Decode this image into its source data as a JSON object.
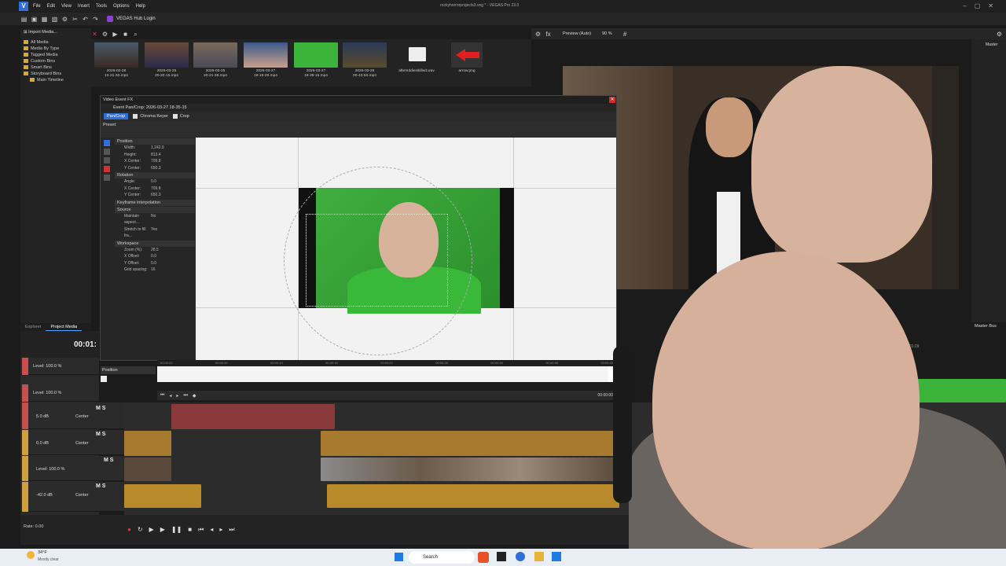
{
  "app": {
    "window_title": "rockyhorrorprojects3.veg * - VEGAS Pro 23.0",
    "menu": [
      "File",
      "Edit",
      "View",
      "Insert",
      "Tools",
      "Options",
      "Help"
    ],
    "hub_label": "VEGAS Hub Login"
  },
  "explorer": {
    "import_label": "Import Media...",
    "tree": [
      "All Media",
      "Media By Type",
      "Tagged Media",
      "Custom Bins",
      "Smart Bins",
      "Storyboard Bins",
      "Main Timeline"
    ],
    "tabs": [
      "Explorer",
      "Project Media"
    ]
  },
  "media": [
    {
      "name": "2026-02-28\n12-21-30.mp4"
    },
    {
      "name": "2026-03-25\n20-20-15.mp4"
    },
    {
      "name": "2026-03-25\n20-21-38.mp4"
    },
    {
      "name": "2026-03-27\n18-16-29.mp4"
    },
    {
      "name": "2026-03-27\n18-35-15.mp4"
    },
    {
      "name": "2026-03-28\n00-43-50.mp4"
    },
    {
      "name": "aftereddieiskilled.wav"
    },
    {
      "name": "arrow.png"
    }
  ],
  "preview_toolbar": {
    "mode": "Preview (Auto)",
    "zoom": "90 %"
  },
  "vefx": {
    "title": "Video Event FX",
    "event": "Event Pan/Crop: 2026-03-27 18-35-15",
    "chain": [
      "Pan/Crop",
      "Chroma Keyer",
      "Crop"
    ],
    "preset_label": "Preset:",
    "sections": [
      {
        "name": "Position",
        "rows": [
          [
            "Width:",
            "1,242.9"
          ],
          [
            "Height:",
            "813.4"
          ],
          [
            "X Center:",
            "709.8"
          ],
          [
            "Y Center:",
            "650.3"
          ]
        ]
      },
      {
        "name": "Rotation",
        "rows": [
          [
            "Angle:",
            "0.0"
          ],
          [
            "X Center:",
            "709.8"
          ],
          [
            "Y Center:",
            "650.3"
          ]
        ]
      },
      {
        "name": "Keyframe interpolation",
        "rows": []
      },
      {
        "name": "Source",
        "rows": [
          [
            "Maintain aspect...",
            "No"
          ],
          [
            "Stretch to fill fra...",
            "Yes"
          ]
        ]
      },
      {
        "name": "Workspace",
        "rows": [
          [
            "Zoom (%):",
            "28.5"
          ],
          [
            "X Offset:",
            "0.0"
          ],
          [
            "Y Offset:",
            "0.0"
          ],
          [
            "Grid spacing:",
            "16"
          ]
        ]
      }
    ],
    "position_label": "Position",
    "ruler": [
      "00:00:00",
      "00:00:00",
      "00:00:10",
      "00:00:15",
      "00:00:20",
      "00:00:25",
      "00:00:30",
      "00:00:35",
      "00:00:40"
    ],
    "end_time": "00:00:00"
  },
  "timeline": {
    "time": "00:01:",
    "master_bus": "Master Bus",
    "master": "Master",
    "tracks": [
      {
        "type": "video",
        "level": "Level: 100.0 %"
      },
      {
        "type": "video",
        "level": "Level: 100.0 %"
      },
      {
        "type": "audio",
        "db": "5.0 dB",
        "pan": "Center"
      },
      {
        "type": "audio",
        "db": "0.0 dB",
        "pan": "Center"
      },
      {
        "type": "video",
        "level": "Level: 100.0 %"
      },
      {
        "type": "audio",
        "db": "-42.0 dB",
        "pan": "Center"
      }
    ],
    "rate": "Rate: 0.00",
    "ruler_marks": [
      "00:01:29",
      "00:00:00"
    ],
    "counter": "53:04"
  },
  "taskbar": {
    "weather_temp": "34°F",
    "weather_desc": "Mostly clear",
    "search": "Search"
  },
  "colors": {
    "accent": "#2f6fd6",
    "green_screen": "#39b839",
    "audio_clip": "#c98a2b",
    "video_clip": "#5a4a3a"
  }
}
